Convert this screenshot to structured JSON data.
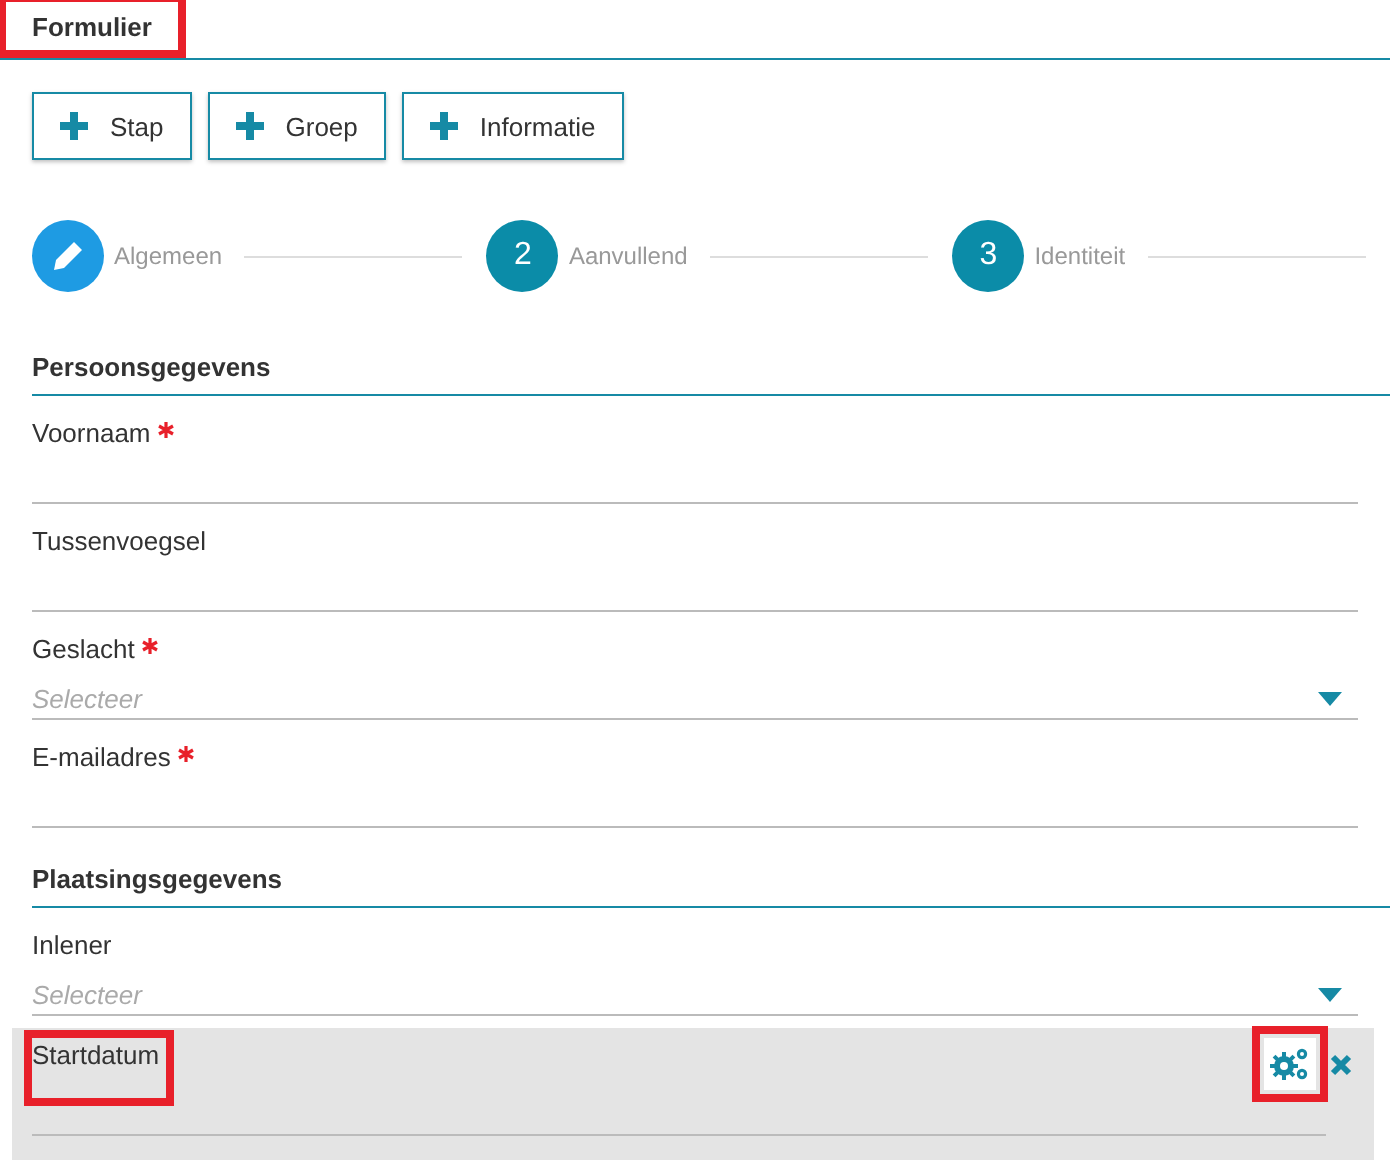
{
  "header": {
    "title": "Formulier",
    "highlighted": true
  },
  "toolbar": [
    {
      "label": "Stap"
    },
    {
      "label": "Groep"
    },
    {
      "label": "Informatie"
    }
  ],
  "steps": [
    {
      "kind": "edit",
      "label": "Algemeen"
    },
    {
      "kind": "number",
      "number": "2",
      "label": "Aanvullend"
    },
    {
      "kind": "number",
      "number": "3",
      "label": "Identiteit"
    }
  ],
  "sections": [
    {
      "title": "Persoonsgegevens",
      "fields": [
        {
          "kind": "text",
          "label": "Voornaam",
          "required": true
        },
        {
          "kind": "text",
          "label": "Tussenvoegsel",
          "required": false
        },
        {
          "kind": "select",
          "label": "Geslacht",
          "required": true,
          "placeholder": "Selecteer"
        },
        {
          "kind": "text",
          "label": "E-mailadres",
          "required": true
        }
      ]
    },
    {
      "title": "Plaatsingsgegevens",
      "fields": [
        {
          "kind": "select",
          "label": "Inlener",
          "required": false,
          "placeholder": "Selecteer"
        },
        {
          "kind": "text",
          "label": "Startdatum",
          "required": false,
          "active": true,
          "highlighted": true,
          "settings_highlighted": true
        }
      ]
    }
  ]
}
